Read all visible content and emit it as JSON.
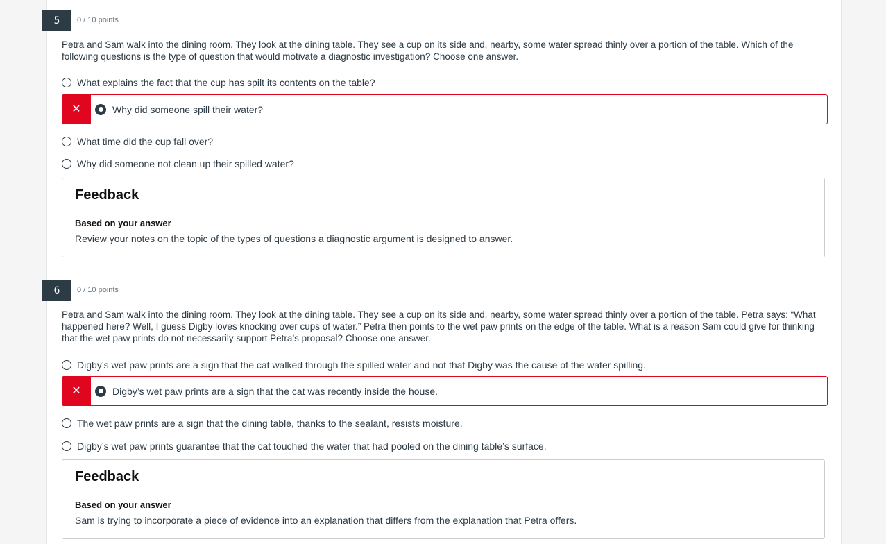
{
  "questions": [
    {
      "number": "5",
      "points": "0 / 10 points",
      "text": "Petra and Sam walk into the dining room.  They look at the dining table.  They see a cup on its side and, nearby, some water spread thinly over a portion of the table.  Which of the following questions is the type of question that would motivate a diagnostic investigation?  Choose one answer.",
      "answers": [
        "What explains the fact that the cup has spilt its contents on the table?",
        "Why did someone spill their water?",
        "What time did the cup fall over?",
        "Why did someone not clean up their spilled water?"
      ],
      "selected_index": 1,
      "wrong_mark": "✕",
      "feedback": {
        "title": "Feedback",
        "subtitle": "Based on your answer",
        "text": "Review your notes on the topic of the types of questions a diagnostic argument is designed to answer."
      }
    },
    {
      "number": "6",
      "points": "0 / 10 points",
      "text": "Petra and Sam walk into the dining room.  They look at the dining table.  They see a cup on its side and, nearby, some water spread thinly over a portion of the table.  Petra says: “What happened here?  Well, I guess Digby loves knocking over cups of water.”  Petra then points to the wet paw prints on the edge of the table.  What is a reason Sam could give for thinking that the wet paw prints do not necessarily support Petra’s proposal?  Choose one answer.",
      "answers": [
        "Digby’s wet paw prints are a sign that the cat walked through the spilled water and not that Digby was the cause of the water spilling.",
        "Digby’s wet paw prints are a sign that the cat was recently inside the house.",
        "The wet paw prints are a sign that the dining table, thanks to the sealant, resists moisture.",
        "Digby’s wet paw prints guarantee that the cat touched the water that had pooled on the dining table’s surface."
      ],
      "selected_index": 1,
      "wrong_mark": "✕",
      "feedback": {
        "title": "Feedback",
        "subtitle": "Based on your answer",
        "text": "Sam is trying to incorporate a piece of evidence into an explanation that differs from the explanation that Petra offers."
      }
    }
  ],
  "colors": {
    "accent_dark": "#2d3b45",
    "incorrect": "#e0061f",
    "border": "#c7cdd1"
  }
}
